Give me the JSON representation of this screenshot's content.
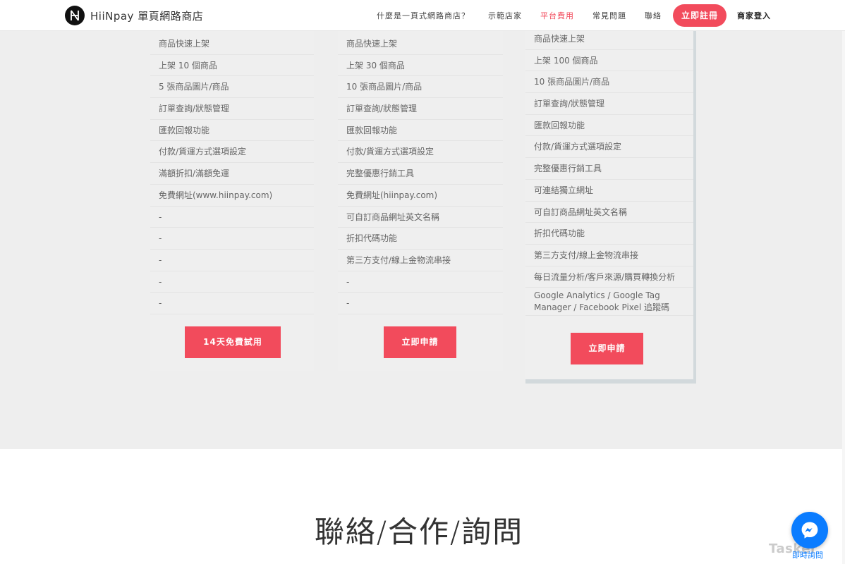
{
  "header": {
    "brand": "HiiNpay 單頁網路商店",
    "nav": [
      {
        "label": "什麼是一頁式網路商店？"
      },
      {
        "label": "示範店家"
      },
      {
        "label": "平台費用"
      },
      {
        "label": "常見問題"
      },
      {
        "label": "聯絡"
      }
    ],
    "cta": "立即註冊",
    "login": "商家登入",
    "accent_color": "#f24b5c"
  },
  "plans": [
    {
      "features": [
        "商品快速上架",
        "上架 10 個商品",
        "5 張商品圖片/商品",
        "訂單查詢/狀態管理",
        "匯款回報功能",
        "付款/貨運方式選項設定",
        "滿額折扣/滿額免運",
        "免費網址(www.hiinpay.com)",
        "-",
        "-",
        "-",
        "-",
        "-"
      ],
      "button": "14天免費試用"
    },
    {
      "features": [
        "商品快速上架",
        "上架 30 個商品",
        "10 張商品圖片/商品",
        "訂單查詢/狀態管理",
        "匯款回報功能",
        "付款/貨運方式選項設定",
        "完整優惠行銷工具",
        "免費網址(hiinpay.com)",
        "可自訂商品網址英文名稱",
        "折扣代碼功能",
        "第三方支付/線上金物流串接",
        "-",
        "-"
      ],
      "button": "立即申請"
    },
    {
      "features": [
        "商品快速上架",
        "上架 100 個商品",
        "10 張商品圖片/商品",
        "訂單查詢/狀態管理",
        "匯款回報功能",
        "付款/貨運方式選項設定",
        "完整優惠行銷工具",
        "可連結獨立網址",
        "可自訂商品網址英文名稱",
        "折扣代碼功能",
        "第三方支付/線上金物流串接",
        "每日流量分析/客戶來源/購買轉換分析",
        "Google Analytics / Google Tag Manager / Facebook Pixel 追蹤碼"
      ],
      "button": "立即申請"
    }
  ],
  "contact": {
    "title": "聯絡/合作/詢問"
  },
  "messenger": {
    "label": "即時詢問",
    "icon": "messenger-icon",
    "color": "#0a7cff"
  },
  "watermark": "Tasker"
}
